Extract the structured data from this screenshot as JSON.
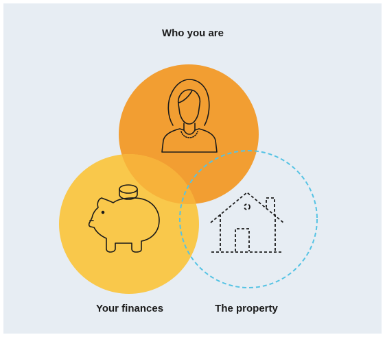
{
  "diagram": {
    "labels": {
      "who": "Who you are",
      "finances": "Your finances",
      "property": "The property"
    },
    "icons": {
      "who": "woman-portrait-icon",
      "finances": "piggy-bank-icon",
      "property": "house-icon"
    },
    "colors": {
      "background": "#e7edf3",
      "who_circle": "#f29e32",
      "finances_circle": "#f9c84b",
      "overlap": "#f7b23a",
      "property_circle_stroke": "#55c3e4",
      "icon_stroke": "#1a1a1a"
    }
  }
}
